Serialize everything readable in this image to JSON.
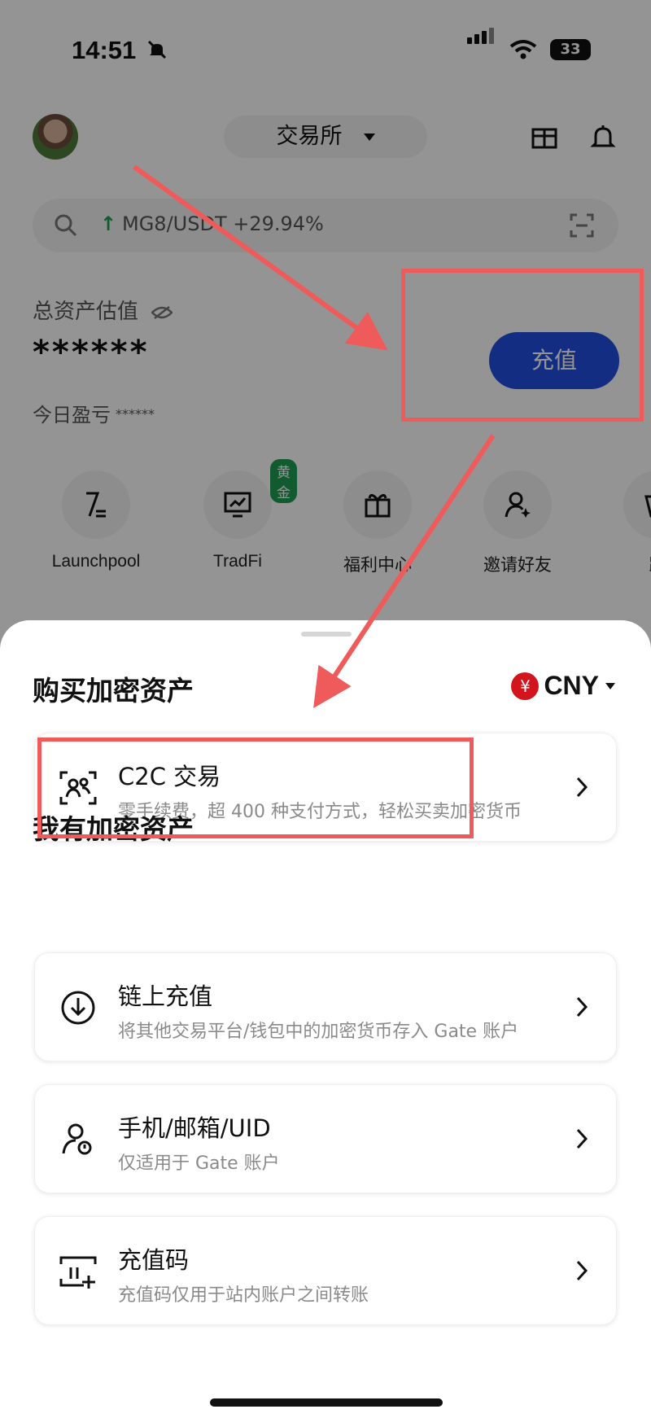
{
  "status_bar": {
    "time": "14:51",
    "battery": "33"
  },
  "header": {
    "exchange_label": "交易所"
  },
  "search": {
    "ticker_text": "MG8/USDT +29.94%"
  },
  "assets": {
    "label": "总资产估值",
    "value_masked": "******",
    "today_label": "今日盈亏",
    "today_masked": "******",
    "recharge_button": "充值"
  },
  "quick_actions": [
    {
      "label": "Launchpool",
      "icon": "launchpool-icon"
    },
    {
      "label": "TradFi",
      "icon": "chart-monitor-icon",
      "badge": "黄金"
    },
    {
      "label": "福利中心",
      "icon": "gift-icon"
    },
    {
      "label": "邀请好友",
      "icon": "invite-user-icon"
    },
    {
      "label": "跟",
      "icon": "copy-trade-icon"
    }
  ],
  "sheet": {
    "buy_section_title": "购买加密资产",
    "currency": {
      "symbol": "¥",
      "code": "CNY"
    },
    "c2c": {
      "title": "C2C 交易",
      "subtitle": "零手续费，超 400 种支付方式，轻松买卖加密货币"
    },
    "have_section_title": "我有加密资产",
    "options": [
      {
        "title": "链上充值",
        "subtitle": "将其他交易平台/钱包中的加密货币存入 Gate 账户",
        "icon": "download-icon"
      },
      {
        "title": "手机/邮箱/UID",
        "subtitle": "仅适用于 Gate 账户",
        "icon": "user-transfer-icon"
      },
      {
        "title": "充值码",
        "subtitle": "充值码仅用于站内账户之间转账",
        "icon": "code-scan-icon"
      }
    ]
  },
  "colors": {
    "accent_blue": "#1f4fe0",
    "annotation_red": "#ef5b5b",
    "yen_red": "#d3141c",
    "gain_green": "#1f9d55"
  }
}
